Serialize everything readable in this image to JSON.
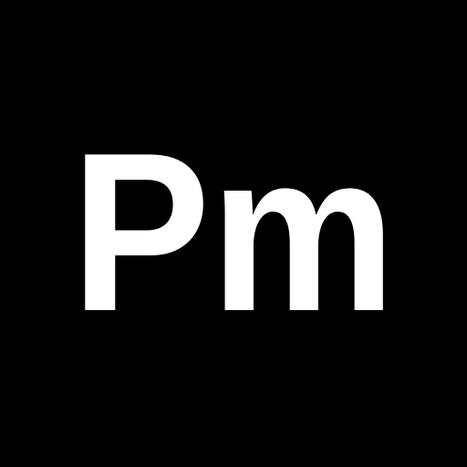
{
  "icon": {
    "text": "Pm",
    "background_color": "#000000",
    "text_color": "#ffffff"
  }
}
